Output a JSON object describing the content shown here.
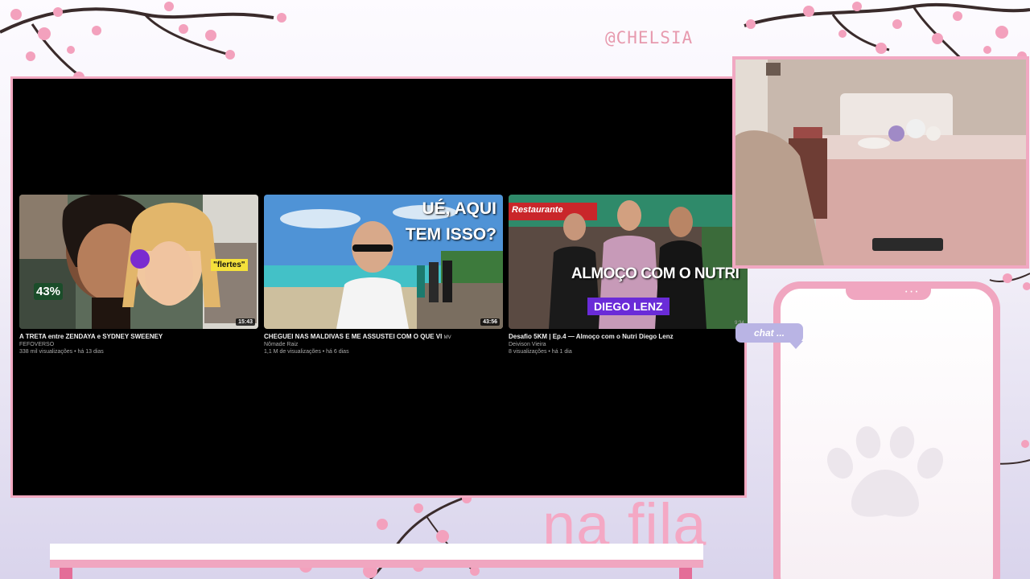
{
  "overlay": {
    "handle": "@CHELSIA",
    "chat_bubble": "chat ...",
    "queue_label": "na fila",
    "phone_dots": "• • •"
  },
  "videos": [
    {
      "title": "A TRETA entre ZENDAYA e SYDNEY SWEENEY",
      "channel": "FEFOVERSO",
      "meta": "338 mil visualizações • há 13 dias",
      "duration": "15:43",
      "thumb_badge": "43%",
      "thumb_tag": "\"flertes\""
    },
    {
      "title": "CHEGUEI NAS MALDIVAS E ME ASSUSTEI COM O QUE VI",
      "title_suffix": "MV",
      "channel": "Nômade Raiz",
      "meta": "1,1 M de visualizações • há 6 dias",
      "duration": "43:56",
      "thumb_line1": "UÉ, AQUI",
      "thumb_line2": "TEM ISSO?"
    },
    {
      "title": "Desafio 5KM | Ep.4 — Almoço com o Nutri Diego Lenz",
      "channel": "Deivison Vieira",
      "meta": "8 visualizações • há 1 dia",
      "duration": "9:34",
      "thumb_line1": "ALMOÇO COM O NUTRI",
      "thumb_line2": "DIEGO LENZ",
      "thumb_sign": "Restaurante"
    }
  ],
  "colors": {
    "accent_pink": "#f0a6c0",
    "handle_pink": "#e79aae",
    "chat_lavender": "#b9b4e4",
    "screen_bg": "#000000"
  }
}
